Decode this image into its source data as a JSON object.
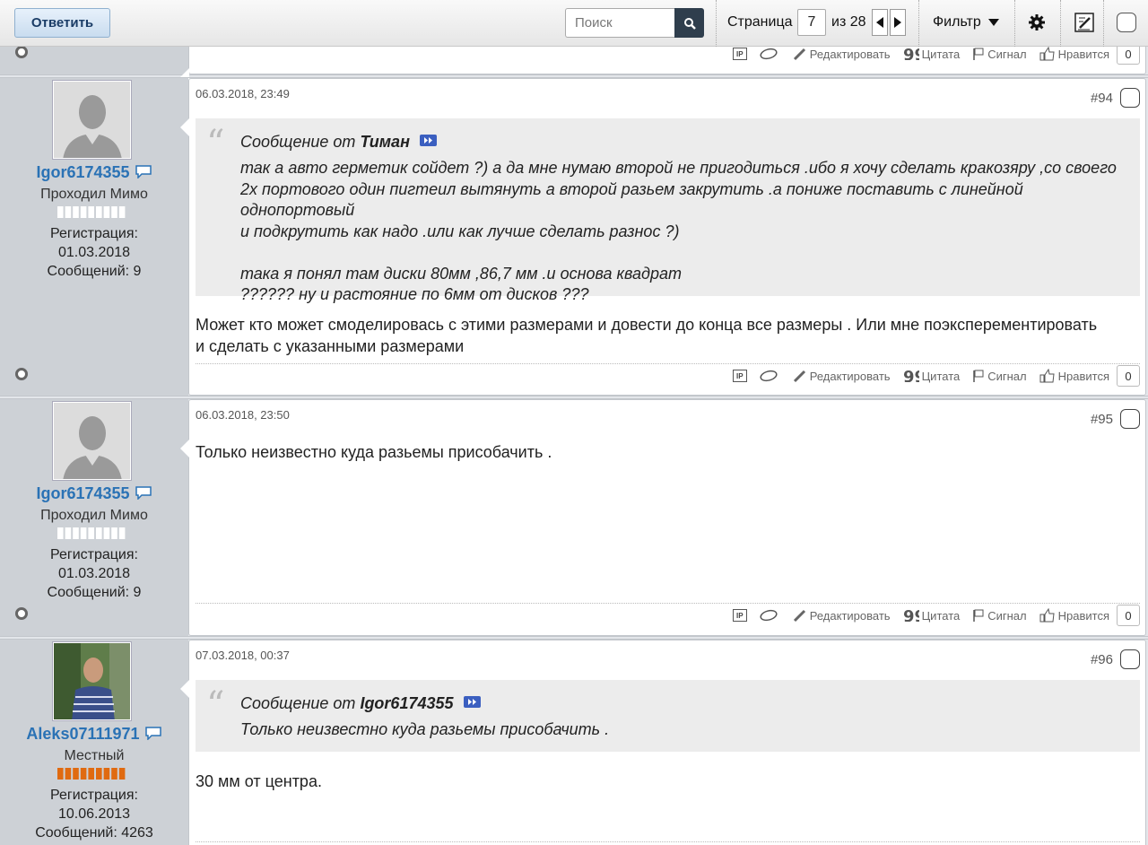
{
  "toolbar": {
    "reply_label": "Ответить",
    "search_placeholder": "Поиск",
    "page_label": "Страница",
    "page_value": "7",
    "page_of": "из 28",
    "filter_label": "Фильтр"
  },
  "actions": {
    "edit": "Редактировать",
    "quote": "Цитата",
    "report": "Сигнал",
    "like": "Нравится",
    "like_count": "0"
  },
  "posts": [
    {
      "number": "#94",
      "date": "06.03.2018, 23:49",
      "user": {
        "name": "Igor6174355",
        "title": "Проходил Мимо",
        "reg_label": "Регистрация:",
        "reg_date": "01.03.2018",
        "posts": "Сообщений: 9"
      },
      "quote": {
        "prefix": "Сообщение от",
        "author": "Тиман",
        "lines": [
          "так а авто герметик сойдет ?) а да мне нумаю второй не пригодиться .ибо я хочу сделать кракозяру ,со своего",
          "2х портового один пигтеил вытянуть а второй разьем закрутить .а пониже поставить с линейной однопортовый",
          "и подкрутить как надо .или как лучше сделать разнос ?)",
          "",
          "така я понял там диски 80мм ,86,7 мм .и основа квадрат",
          "?????? ну и растояние по 6мм от дисков ???"
        ]
      },
      "message_lines": [
        "Может кто может смоделировась с этими размерами и довести до конца все размеры . Или мне поэксперементировать",
        "и сделать с указанными размерами"
      ]
    },
    {
      "number": "#95",
      "date": "06.03.2018, 23:50",
      "user": {
        "name": "Igor6174355",
        "title": "Проходил Мимо",
        "reg_label": "Регистрация:",
        "reg_date": "01.03.2018",
        "posts": "Сообщений: 9"
      },
      "message_lines": [
        "Только неизвестно куда разьемы присобачить ."
      ]
    },
    {
      "number": "#96",
      "date": "07.03.2018, 00:37",
      "user": {
        "name": "Aleks07111971",
        "title": "Местный",
        "reg_label": "Регистрация:",
        "reg_date": "10.06.2013",
        "posts": "Сообщений: 4263"
      },
      "quote": {
        "prefix": "Сообщение от",
        "author": "Igor6174355",
        "lines": [
          "Только неизвестно куда разьемы присобачить ."
        ]
      },
      "message_lines": [
        "30 мм от центра."
      ]
    }
  ],
  "colors": {
    "username": "#2a72b5",
    "rep_empty": "#ffffff",
    "rep_full": "#e06a10",
    "quote_bg": "#ececec",
    "side_bg": "#cdd1d6"
  }
}
